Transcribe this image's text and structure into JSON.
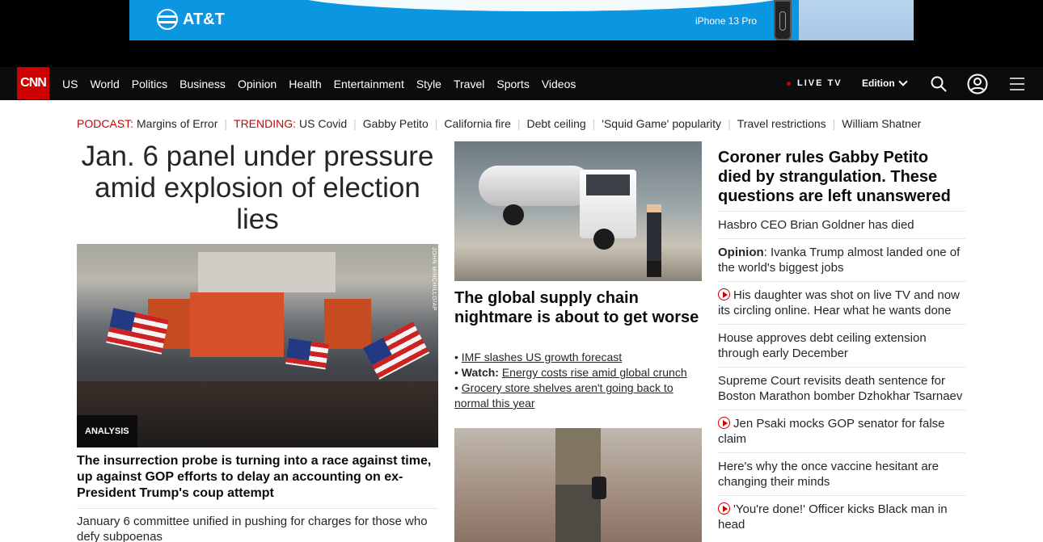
{
  "ad": {
    "brand": "AT&T",
    "product": "iPhone 13 Pro"
  },
  "nav": {
    "logo": "CNN",
    "links": [
      "US",
      "World",
      "Politics",
      "Business",
      "Opinion",
      "Health",
      "Entertainment",
      "Style",
      "Travel",
      "Sports",
      "Videos"
    ],
    "live": "LIVE TV",
    "edition": "Edition",
    "icons": [
      "search-icon",
      "account-icon",
      "menu-icon"
    ]
  },
  "trending": {
    "podcast_tag": "PODCAST:",
    "podcast": "Margins of Error",
    "trending_tag": "TRENDING:",
    "items": [
      "US Covid",
      "Gabby Petito",
      "California fire",
      "Debt ceiling",
      "'Squid Game' popularity",
      "Travel restrictions",
      "William Shatner"
    ]
  },
  "hero": {
    "title": "Jan. 6 panel under pressure amid explosion of election lies",
    "badge": "ANALYSIS",
    "credit": "JOHN MINCHILLO/AP",
    "subhead": "The insurrection probe is turning into a race against time, up against GOP efforts to delay an accounting on ex-President Trump's coup attempt",
    "more": "January 6 committee unified in pushing for charges for those who defy subpoenas"
  },
  "supply": {
    "title": "The global supply chain nightmare is about to get worse",
    "bullet1": "IMF slashes US growth forecast",
    "bullet2_bold": "Watch:",
    "bullet2": "Energy costs rise amid global crunch",
    "bullet3": "Grocery store shelves aren't going back to normal this year"
  },
  "right": {
    "lead": "Coroner rules Gabby Petito died by strangulation. These questions are left unanswered",
    "items": [
      "Hasbro CEO Brian Goldner has died",
      "Ivanka Trump almost landed one of the world's biggest jobs",
      "His daughter was shot on live TV and now its circling online. Hear what he wants done",
      "House approves debt ceiling extension through early December",
      "Supreme Court revisits death sentence for Boston Marathon bomber Dzhokhar Tsarnaev",
      "Jen Psaki mocks GOP senator for false claim",
      "Here's why the once vaccine hesitant are changing their minds",
      "'You're done!' Officer kicks Black man in head"
    ],
    "opinion_label": "Opinion"
  },
  "colors": {
    "brand": "#cc0000",
    "nav_bg": "#0c0c0c",
    "ad_bg": "#0a96e0"
  }
}
